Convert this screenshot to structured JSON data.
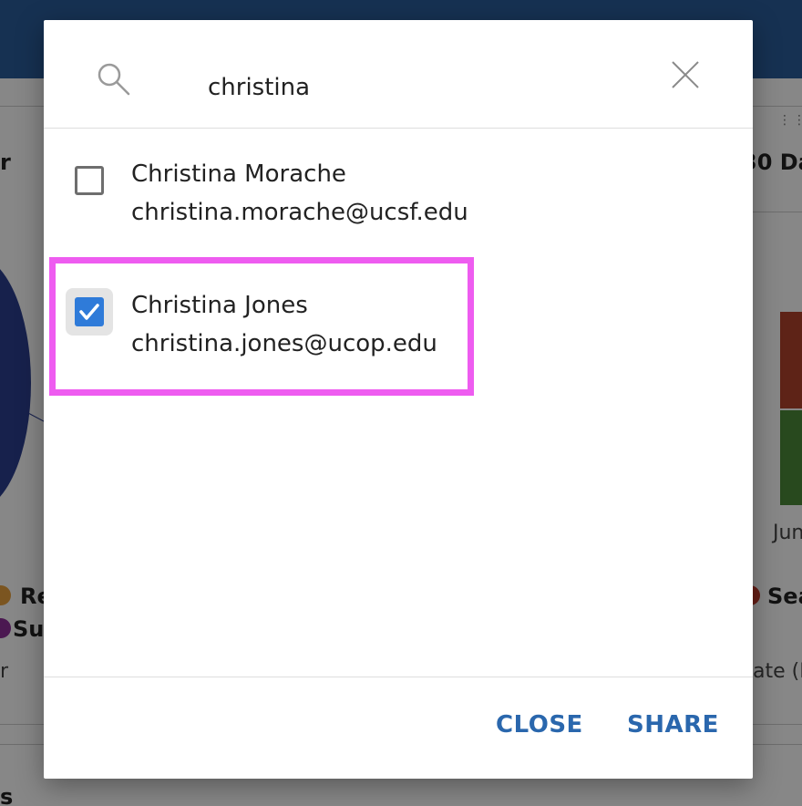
{
  "background": {
    "left_labels": [
      "r",
      "Re",
      "Suz",
      "r",
      "s"
    ],
    "right_labels": [
      "30 Da",
      "Jun",
      "Sea",
      "ate (M"
    ]
  },
  "search": {
    "value": "christina"
  },
  "results": [
    {
      "name": "Christina Morache",
      "email": "christina.morache@ucsf.edu",
      "checked": false
    },
    {
      "name": "Christina Jones",
      "email": "christina.jones@ucop.edu",
      "checked": true
    }
  ],
  "actions": {
    "close_label": "CLOSE",
    "share_label": "SHARE"
  },
  "colors": {
    "accent": "#2a67ad",
    "checkbox_checked": "#2f7bd9",
    "highlight": "#ee5cf0"
  }
}
